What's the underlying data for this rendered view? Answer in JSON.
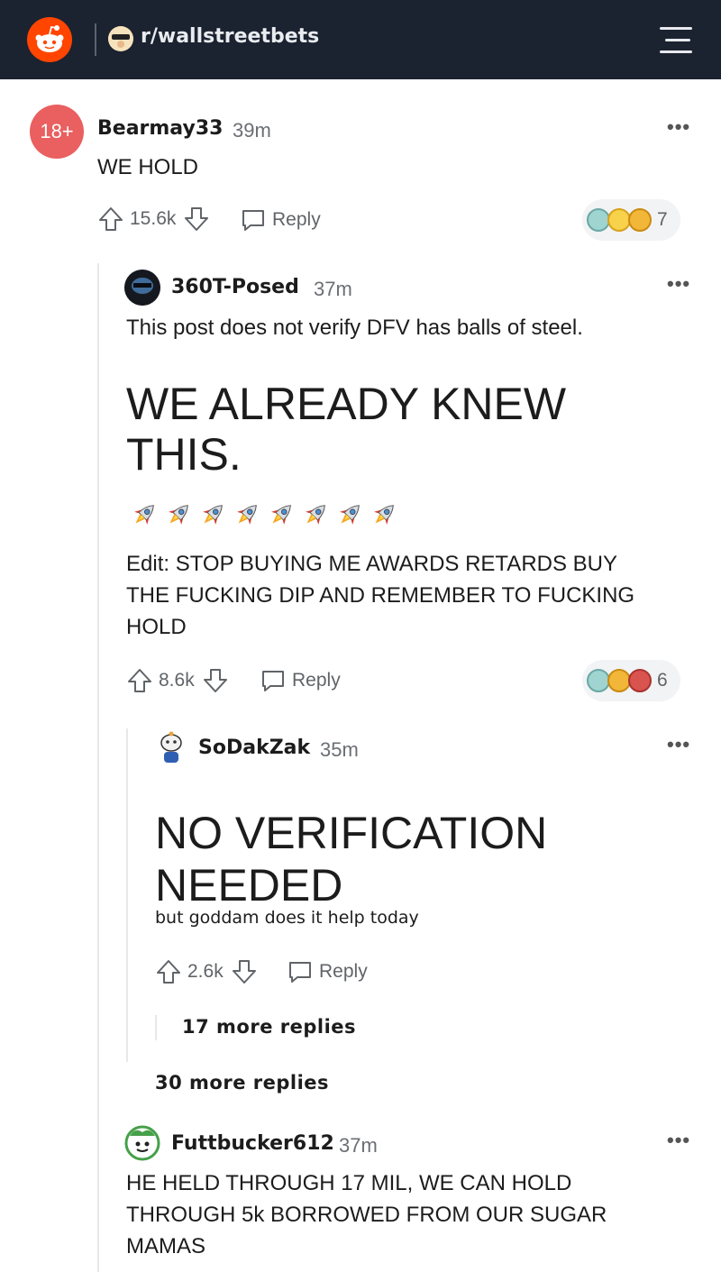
{
  "header": {
    "subreddit": "r/wallstreetbets",
    "menu_icon": "hamburger-icon",
    "logo_icon": "reddit-logo-icon"
  },
  "comments": [
    {
      "badge": "18+",
      "author": "Bearmay33",
      "time": "39m",
      "text": "WE HOLD",
      "upvotes": "15.6k",
      "reply_label": "Reply",
      "award_count": "7"
    },
    {
      "author": "360T-Posed",
      "time": "37m",
      "text": "This post does not verify DFV has balls of steel.",
      "heading_line1": "WE ALREADY KNEW",
      "heading_line2": "THIS.",
      "rockets": 8,
      "edit_line1": "Edit: STOP BUYING ME AWARDS RETARDS BUY",
      "edit_line2": "THE FUCKING DIP AND REMEMBER TO FUCKING",
      "edit_line3": "HOLD",
      "upvotes": "8.6k",
      "reply_label": "Reply",
      "award_count": "6"
    },
    {
      "author": "SoDakZak",
      "time": "35m",
      "heading_line1": "NO VERIFICATION",
      "heading_line2": "NEEDED",
      "subtext": "but goddam does it help today",
      "upvotes": "2.6k",
      "reply_label": "Reply",
      "more_replies": "17 more replies"
    },
    {
      "more_replies": "30 more replies"
    },
    {
      "author": "Futtbucker612",
      "time": "37m",
      "text_line1": "HE HELD THROUGH 17 MIL, WE CAN HOLD",
      "text_line2": "THROUGH 5k BORROWED FROM OUR SUGAR",
      "text_line3": "MAMAS"
    }
  ],
  "more_options": "•••",
  "colors": {
    "topbar": "#1b2230",
    "reddit_orange": "#ff4500",
    "nsfw_badge": "#ea5f5f"
  }
}
